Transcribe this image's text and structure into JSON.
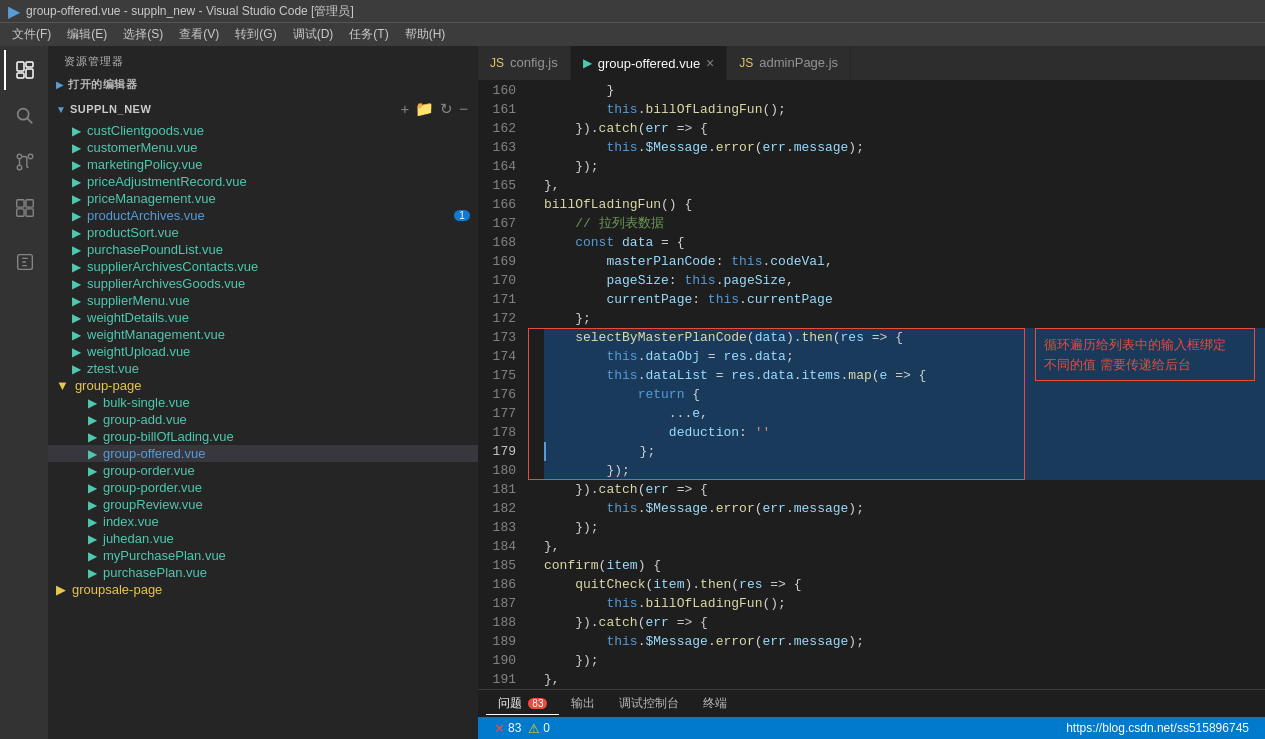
{
  "titlebar": {
    "icon": "▶",
    "title": "group-offered.vue - suppln_new - Visual Studio Code [管理员]",
    "menus": [
      "文件(F)",
      "编辑(E)",
      "选择(S)",
      "查看(V)",
      "转到(G)",
      "调试(D)",
      "任务(T)",
      "帮助(H)"
    ]
  },
  "sidebar": {
    "header": "资源管理器",
    "open_editors": "打开的编辑器",
    "project_name": "SUPPLN_NEW",
    "files": [
      {
        "name": "custClientgoods.vue",
        "type": "vue",
        "indent": 1
      },
      {
        "name": "customerMenu.vue",
        "type": "vue",
        "indent": 1
      },
      {
        "name": "marketingPolicy.vue",
        "type": "vue",
        "indent": 1
      },
      {
        "name": "priceAdjustmentRecord.vue",
        "type": "vue",
        "indent": 1
      },
      {
        "name": "priceManagement.vue",
        "type": "vue",
        "indent": 1
      },
      {
        "name": "productArchives.vue",
        "type": "vue",
        "indent": 1,
        "active": true,
        "badge": "1"
      },
      {
        "name": "productSort.vue",
        "type": "vue",
        "indent": 1
      },
      {
        "name": "purchasePoundList.vue",
        "type": "vue",
        "indent": 1
      },
      {
        "name": "supplierArchivesContacts.vue",
        "type": "vue",
        "indent": 1
      },
      {
        "name": "supplierArchivesGoods.vue",
        "type": "vue",
        "indent": 1
      },
      {
        "name": "supplierMenu.vue",
        "type": "vue",
        "indent": 1
      },
      {
        "name": "weightDetails.vue",
        "type": "vue",
        "indent": 1
      },
      {
        "name": "weightManagement.vue",
        "type": "vue",
        "indent": 1
      },
      {
        "name": "weightUpload.vue",
        "type": "vue",
        "indent": 1
      },
      {
        "name": "ztest.vue",
        "type": "vue",
        "indent": 1
      },
      {
        "name": "group-page",
        "type": "folder",
        "indent": 1,
        "open": true
      },
      {
        "name": "bulk-single.vue",
        "type": "vue",
        "indent": 2
      },
      {
        "name": "group-add.vue",
        "type": "vue",
        "indent": 2
      },
      {
        "name": "group-billOfLading.vue",
        "type": "vue",
        "indent": 2
      },
      {
        "name": "group-offered.vue",
        "type": "vue",
        "indent": 2,
        "current": true
      },
      {
        "name": "group-order.vue",
        "type": "vue",
        "indent": 2
      },
      {
        "name": "group-porder.vue",
        "type": "vue",
        "indent": 2
      },
      {
        "name": "groupReview.vue",
        "type": "vue",
        "indent": 2
      },
      {
        "name": "index.vue",
        "type": "vue",
        "indent": 2
      },
      {
        "name": "juhedan.vue",
        "type": "vue",
        "indent": 2
      },
      {
        "name": "myPurchasePlan.vue",
        "type": "vue",
        "indent": 2
      },
      {
        "name": "purchasePlan.vue",
        "type": "vue",
        "indent": 2
      },
      {
        "name": "groupsale-page",
        "type": "folder",
        "indent": 1
      }
    ]
  },
  "tabs": [
    {
      "label": "config.js",
      "type": "js",
      "active": false
    },
    {
      "label": "group-offered.vue",
      "type": "vue",
      "active": true,
      "closeable": true
    },
    {
      "label": "adminPage.js",
      "type": "js",
      "active": false
    }
  ],
  "code": {
    "lines": [
      {
        "num": 160,
        "text": "        }"
      },
      {
        "num": 161,
        "text": "        this.billOfLadingFun();"
      },
      {
        "num": 162,
        "text": "    }).catch(err => {"
      },
      {
        "num": 163,
        "text": "        this.$Message.error(err.message);"
      },
      {
        "num": 164,
        "text": "    });"
      },
      {
        "num": 165,
        "text": "},"
      },
      {
        "num": 166,
        "text": "billOfLadingFun() {"
      },
      {
        "num": 167,
        "text": "    // 拉列表数据"
      },
      {
        "num": 168,
        "text": "    const data = {"
      },
      {
        "num": 169,
        "text": "        masterPlanCode: this.codeVal,"
      },
      {
        "num": 170,
        "text": "        pageSize: this.pageSize,"
      },
      {
        "num": 171,
        "text": "        currentPage: this.currentPage"
      },
      {
        "num": 172,
        "text": "    };"
      },
      {
        "num": 173,
        "text": "    selectByMasterPlanCode(data).then(res => {",
        "highlight": true
      },
      {
        "num": 174,
        "text": "        this.dataObj = res.data;",
        "highlight": true
      },
      {
        "num": 175,
        "text": "        this.dataList = res.data.items.map(e => {",
        "highlight": true
      },
      {
        "num": 176,
        "text": "            return {",
        "highlight": true
      },
      {
        "num": 177,
        "text": "                ...e,",
        "highlight": true
      },
      {
        "num": 178,
        "text": "                deduction: ''",
        "highlight": true
      },
      {
        "num": 179,
        "text": "            };",
        "highlight": true,
        "current": true
      },
      {
        "num": 180,
        "text": "        });",
        "highlight": true
      },
      {
        "num": 181,
        "text": "    }).catch(err => {"
      },
      {
        "num": 182,
        "text": "        this.$Message.error(err.message);"
      },
      {
        "num": 183,
        "text": "    });"
      },
      {
        "num": 184,
        "text": "},"
      },
      {
        "num": 185,
        "text": "confirm(item) {"
      },
      {
        "num": 186,
        "text": "    quitCheck(item).then(res => {"
      },
      {
        "num": 187,
        "text": "        this.billOfLadingFun();"
      },
      {
        "num": 188,
        "text": "    }).catch(err => {"
      },
      {
        "num": 189,
        "text": "        this.$Message.error(err.message);"
      },
      {
        "num": 190,
        "text": "    });"
      },
      {
        "num": 191,
        "text": "},"
      }
    ],
    "annotation": "循环遍历给列表中的输入框绑定\n不同的值  需要传递给后台"
  },
  "panel": {
    "tabs": [
      "问题",
      "输出",
      "调试控制台",
      "终端"
    ],
    "error_count": "83"
  },
  "statusbar": {
    "url": "https://blog.csdn.net/ss515896745"
  }
}
